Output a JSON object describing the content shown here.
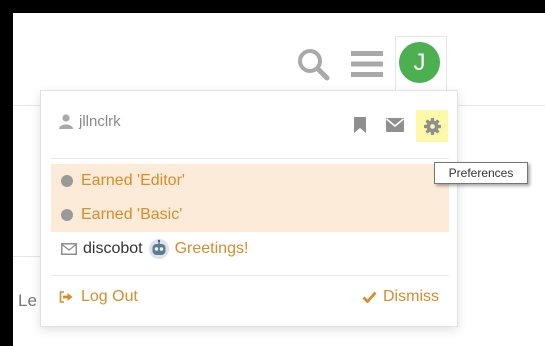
{
  "header": {
    "avatar_letter": "J",
    "avatar_color": "#4caf50",
    "icons": [
      "search-icon",
      "hamburger-icon"
    ]
  },
  "user_menu": {
    "username": "jllnclrk",
    "icons": [
      "person-icon",
      "bookmark-icon",
      "envelope-icon",
      "gear-icon"
    ],
    "notifications": [
      {
        "text": "Earned 'Editor'",
        "highlighted": true
      },
      {
        "text": "Earned 'Basic'",
        "highlighted": true
      },
      {
        "sender": "discobot",
        "text": "Greetings!",
        "highlighted": false
      }
    ],
    "logout_label": "Log Out",
    "dismiss_label": "Dismiss",
    "accent_color": "#d98c2c",
    "highlight_color": "#fbebd8"
  },
  "tooltip": {
    "text": "Preferences"
  },
  "background": {
    "partial_text": "Le"
  }
}
